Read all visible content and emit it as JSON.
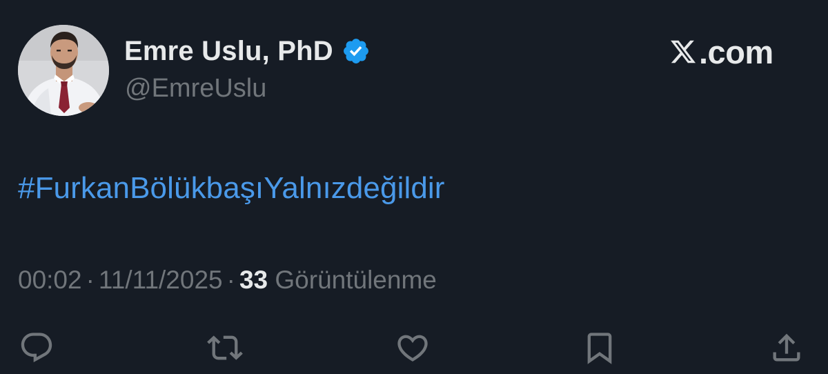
{
  "author": {
    "display_name": "Emre Uslu, PhD",
    "handle": "@EmreUslu",
    "verified": true,
    "badge_color": "#1d9bf0",
    "avatar_icon": "profile-photo"
  },
  "brand": {
    "logo_icon": "x-logo-icon",
    "suffix": ".com"
  },
  "tweet": {
    "text": "#FurkanBölükbaşıYalnızdeğildir",
    "link_color": "#4a99e9"
  },
  "meta": {
    "time": "00:02",
    "separator": "·",
    "date": "11/11/2025",
    "views_count": "33",
    "views_label": "Görüntülenme"
  },
  "actions": [
    {
      "name": "reply",
      "icon": "reply-icon"
    },
    {
      "name": "retweet",
      "icon": "retweet-icon"
    },
    {
      "name": "like",
      "icon": "heart-icon"
    },
    {
      "name": "bookmark",
      "icon": "bookmark-icon"
    },
    {
      "name": "share",
      "icon": "share-icon"
    }
  ],
  "colors": {
    "background": "#161c25",
    "text_primary": "#e7e9ea",
    "text_secondary": "#71767b",
    "icon": "#71767b"
  }
}
